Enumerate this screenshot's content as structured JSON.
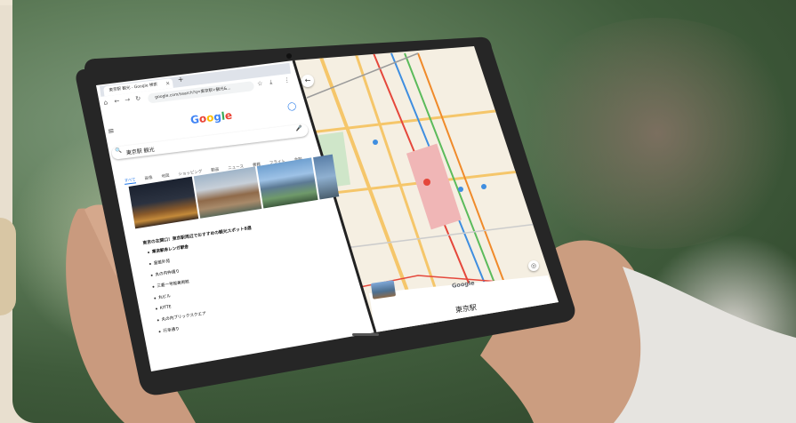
{
  "scene": {
    "description_colors": {
      "background_green": "#4f6e4b",
      "cream_frame": "#e8dfcf",
      "tablet_bezel": "#262626",
      "map_accent_red": "#e5473b",
      "google_blue": "#4285f4"
    }
  },
  "browser": {
    "tab_title": "東京駅 観光 - Google 検索",
    "tab_close": "×",
    "new_tab": "+",
    "url": "google.com/search?q=東京駅+観光&...",
    "logo_letters": [
      "G",
      "o",
      "o",
      "g",
      "l",
      "e"
    ],
    "search_query": "東京駅 観光",
    "chips": [
      "すべて",
      "画像",
      "地図",
      "ショッピング",
      "動画",
      "ニュース",
      "書籍",
      "フライト",
      "金融"
    ],
    "article_title": "東京の玄関口！東京駅周辺でおすすめの観光スポット8選",
    "list_items": [
      "東京駅赤レンガ駅舎",
      "皇居外苑",
      "丸の内仲通り",
      "三菱一号館美術館",
      "丸ビル",
      "KITTE",
      "丸の内ブリックスクエア",
      "行幸通り"
    ]
  },
  "maps": {
    "station_name": "東京駅",
    "back_icon": "←",
    "locate_icon": "◎",
    "google_mark": "Google"
  },
  "icons": {
    "hamburger": "≡",
    "search": "🔍",
    "mic": "🎤",
    "account": "◯",
    "home": "⌂",
    "back": "←",
    "forward": "→",
    "reload": "↻",
    "star": "☆",
    "download": "⤓",
    "menu": "⋮"
  }
}
